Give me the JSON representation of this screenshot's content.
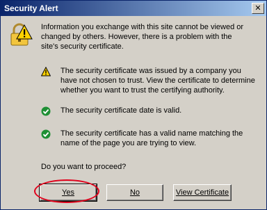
{
  "window": {
    "title": "Security Alert"
  },
  "intro": "Information you exchange with this site cannot be viewed or changed by others. However, there is a problem with the site's security certificate.",
  "items": [
    {
      "icon": "warning-icon",
      "text": "The security certificate was issued by a company you have not chosen to trust. View the certificate to determine whether you want to trust the certifying authority."
    },
    {
      "icon": "check-icon",
      "text": "The security certificate date is valid."
    },
    {
      "icon": "check-icon",
      "text": "The security certificate has a valid name matching the name of the page you are trying to view."
    }
  ],
  "question": "Do you want to proceed?",
  "buttons": {
    "yes_label": "Yes",
    "no_label": "No",
    "view_label": "View Certificate"
  },
  "colors": {
    "title_bar": "#0a246a",
    "highlight": "#e0001b",
    "warning": "#ffd200",
    "check": "#1e8f34"
  }
}
